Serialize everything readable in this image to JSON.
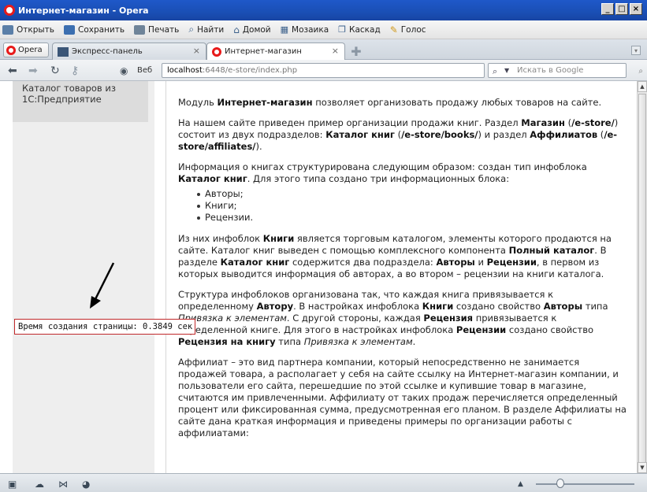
{
  "window": {
    "title": "Интернет-магазин - Opera",
    "controls": [
      "_",
      "□",
      "×"
    ]
  },
  "toolbar": {
    "items": [
      {
        "label": "Открыть",
        "icon": "folder-icon"
      },
      {
        "label": "Сохранить",
        "icon": "save-icon"
      },
      {
        "label": "Печать",
        "icon": "print-icon"
      },
      {
        "label": "Найти",
        "icon": "search-icon"
      },
      {
        "label": "Домой",
        "icon": "home-icon"
      },
      {
        "label": "Мозаика",
        "icon": "tile-icon"
      },
      {
        "label": "Каскад",
        "icon": "cascade-icon"
      },
      {
        "label": "Голос",
        "icon": "voice-icon"
      }
    ]
  },
  "tabs": {
    "opera_menu": "Opera",
    "items": [
      {
        "label": "Экспресс-панель",
        "active": false
      },
      {
        "label": "Интернет-магазин",
        "active": true
      }
    ]
  },
  "address": {
    "web_label": "Веб",
    "url_host": "localhost",
    "url_path": ":6448/e-store/index.php",
    "search_placeholder": "Искать в Google"
  },
  "sidebar": {
    "item_label": "Каталог товаров из 1С:Предприятие"
  },
  "article": {
    "p1": [
      "Модуль ",
      "Интернет-магазин",
      " позволяет организовать продажу любых товаров на сайте."
    ],
    "p2": [
      "На нашем сайте приведен пример организации продажи книг. Раздел ",
      "Магазин",
      " (",
      "/e-store/",
      ") состоит из двух подразделов: ",
      "Каталог книг",
      " (",
      "/e-store/books/",
      ") и раздел ",
      "Аффилиатов",
      " (",
      "/e-store/affiliates/",
      ")."
    ],
    "p3": [
      "Информация о книгах структурирована следующим образом: создан тип инфоблока ",
      "Каталог книг",
      ". Для этого типа создано три информационных блока:"
    ],
    "list": [
      "Авторы;",
      "Книги;",
      "Рецензии."
    ],
    "p4": [
      "Из них инфоблок ",
      "Книги",
      " является торговым каталогом, элементы которого продаются на сайте. Каталог книг выведен с помощью комплексного компонента ",
      "Полный каталог",
      ". В разделе ",
      "Каталог книг",
      " содержится два подраздела: ",
      "Авторы",
      " и ",
      "Рецензии",
      ", в первом из которых выводится информация об авторах, а во втором – рецензии на книги каталога."
    ],
    "p5": [
      "Структура инфоблоков организована так, что каждая книга привязывается к определенному ",
      "Автору",
      ". В настройках инфоблока ",
      "Книги",
      " создано свойство ",
      "Авторы",
      " типа ",
      "Привязка к элементам",
      ". С другой стороны, каждая ",
      "Рецензия",
      " привязывается к определенной книге. Для этого в настройках инфоблока ",
      "Рецензии",
      " создано свойство ",
      "Рецензия на книгу",
      " типа ",
      "Привязка к элементам",
      "."
    ],
    "p6": "Аффилиат – это вид партнера компании, который непосредственно не занимается продажей товара, а располагает у себя на сайте ссылку на Интернет-магазин компании, и пользователи его сайта, перешедшие по этой ссылке и купившие товар в магазине, считаются им привлеченными. Аффилиату от таких продаж перечисляется определенный процент или фиксированная сумма, предусмотренная его планом. В разделе Аффилиаты на сайте дана краткая информация и приведены примеры по организации работы с аффилиатами:"
  },
  "overlay": {
    "timing_text": "Время создания страницы: 0.3849 сек"
  }
}
